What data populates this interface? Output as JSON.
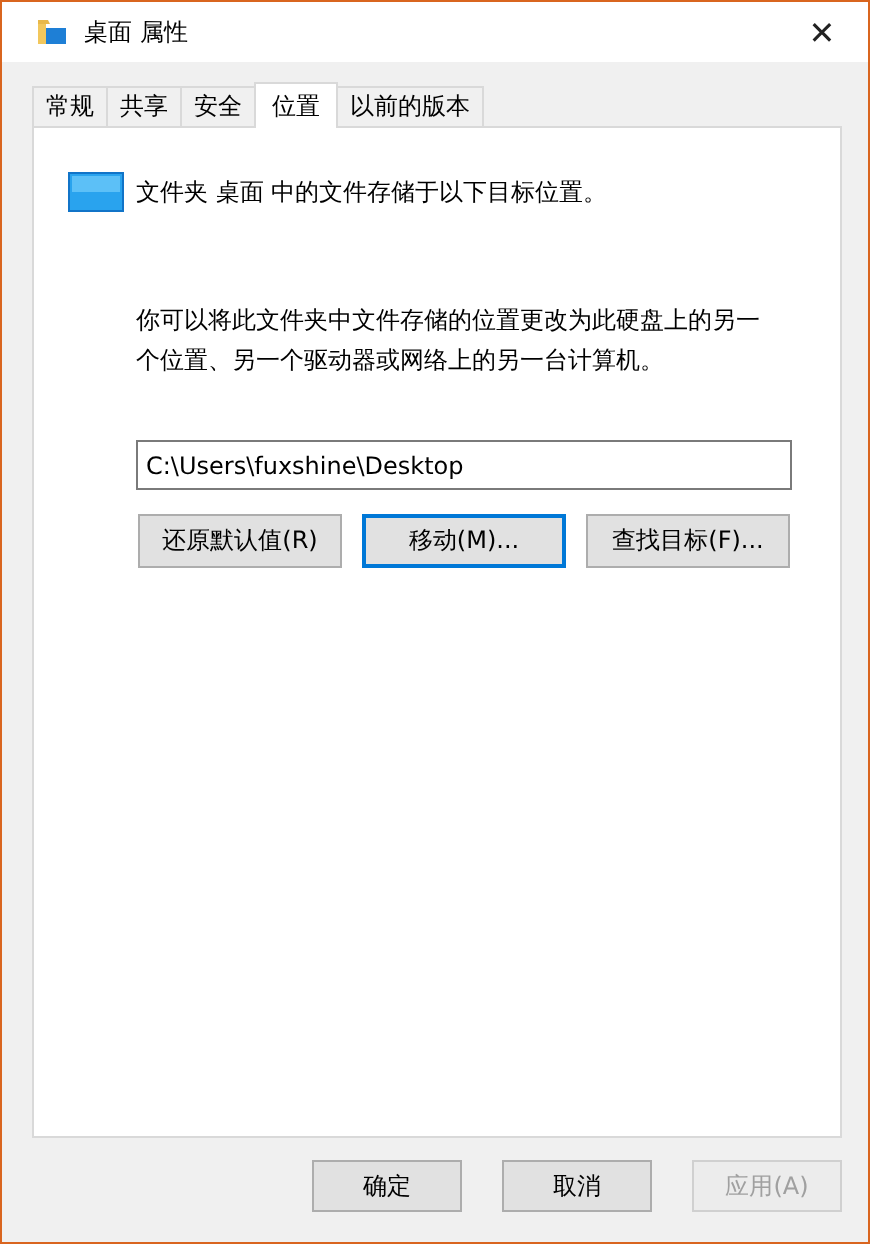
{
  "window": {
    "title": "桌面 属性",
    "close": "✕"
  },
  "tabs": [
    {
      "label": "常规",
      "selected": false
    },
    {
      "label": "共享",
      "selected": false
    },
    {
      "label": "安全",
      "selected": false
    },
    {
      "label": "位置",
      "selected": true
    },
    {
      "label": "以前的版本",
      "selected": false
    }
  ],
  "header_text": "文件夹 桌面 中的文件存储于以下目标位置。",
  "description": "你可以将此文件夹中文件存储的位置更改为此硬盘上的另一个位置、另一个驱动器或网络上的另一台计算机。",
  "path_field": {
    "value": "C:\\Users\\fuxshine\\Desktop"
  },
  "actions": [
    {
      "label": "还原默认值(R)",
      "focused": false
    },
    {
      "label": "移动(M)...",
      "focused": true
    },
    {
      "label": "查找目标(F)...",
      "focused": false
    }
  ],
  "dialog_buttons": [
    {
      "label": "确定",
      "disabled": false
    },
    {
      "label": "取消",
      "disabled": false
    },
    {
      "label": "应用(A)",
      "disabled": true
    }
  ]
}
